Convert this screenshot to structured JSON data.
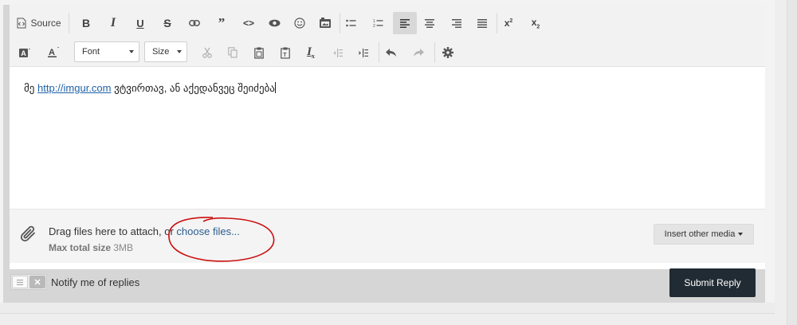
{
  "toolbar": {
    "source_label": "Source",
    "font_label": "Font",
    "size_label": "Size",
    "buttons_row1": [
      "source-icon",
      "bold",
      "italic",
      "underline",
      "strikethrough",
      "link-icon",
      "blockquote-icon",
      "code-icon",
      "preview-icon",
      "emoji-icon",
      "media-icon",
      "bulleted-list-icon",
      "numbered-list-icon",
      "align-left-icon",
      "align-center-icon",
      "align-right-icon",
      "justify-icon",
      "superscript-icon",
      "subscript-icon"
    ],
    "buttons_row2": [
      "text-background-color-icon",
      "text-color-icon",
      "cut-icon",
      "copy-icon",
      "paste-icon",
      "paste-text-icon",
      "remove-format-icon",
      "outdent-icon",
      "indent-icon",
      "undo-icon",
      "redo-icon",
      "settings-icon"
    ]
  },
  "content": {
    "prefix": "მე ",
    "link_text": "http://imgur.com",
    "suffix": " ვტვირთავ, ან აქედანვეც შეიძება"
  },
  "attach": {
    "drag_text": "Drag files here to attach, or ",
    "choose_text": "choose files...",
    "max_label": "Max total size",
    "max_value": "3MB",
    "insert_media_label": "Insert other media",
    "annotation_color": "#cc1111"
  },
  "footer": {
    "notify_label": "Notify me of replies",
    "toggle_off_glyph": "✕",
    "submit_label": "Submit Reply"
  },
  "colors": {
    "submit_bg": "#212b33",
    "link": "#1f62a8",
    "toolbar_bg": "#f2f2f2"
  }
}
